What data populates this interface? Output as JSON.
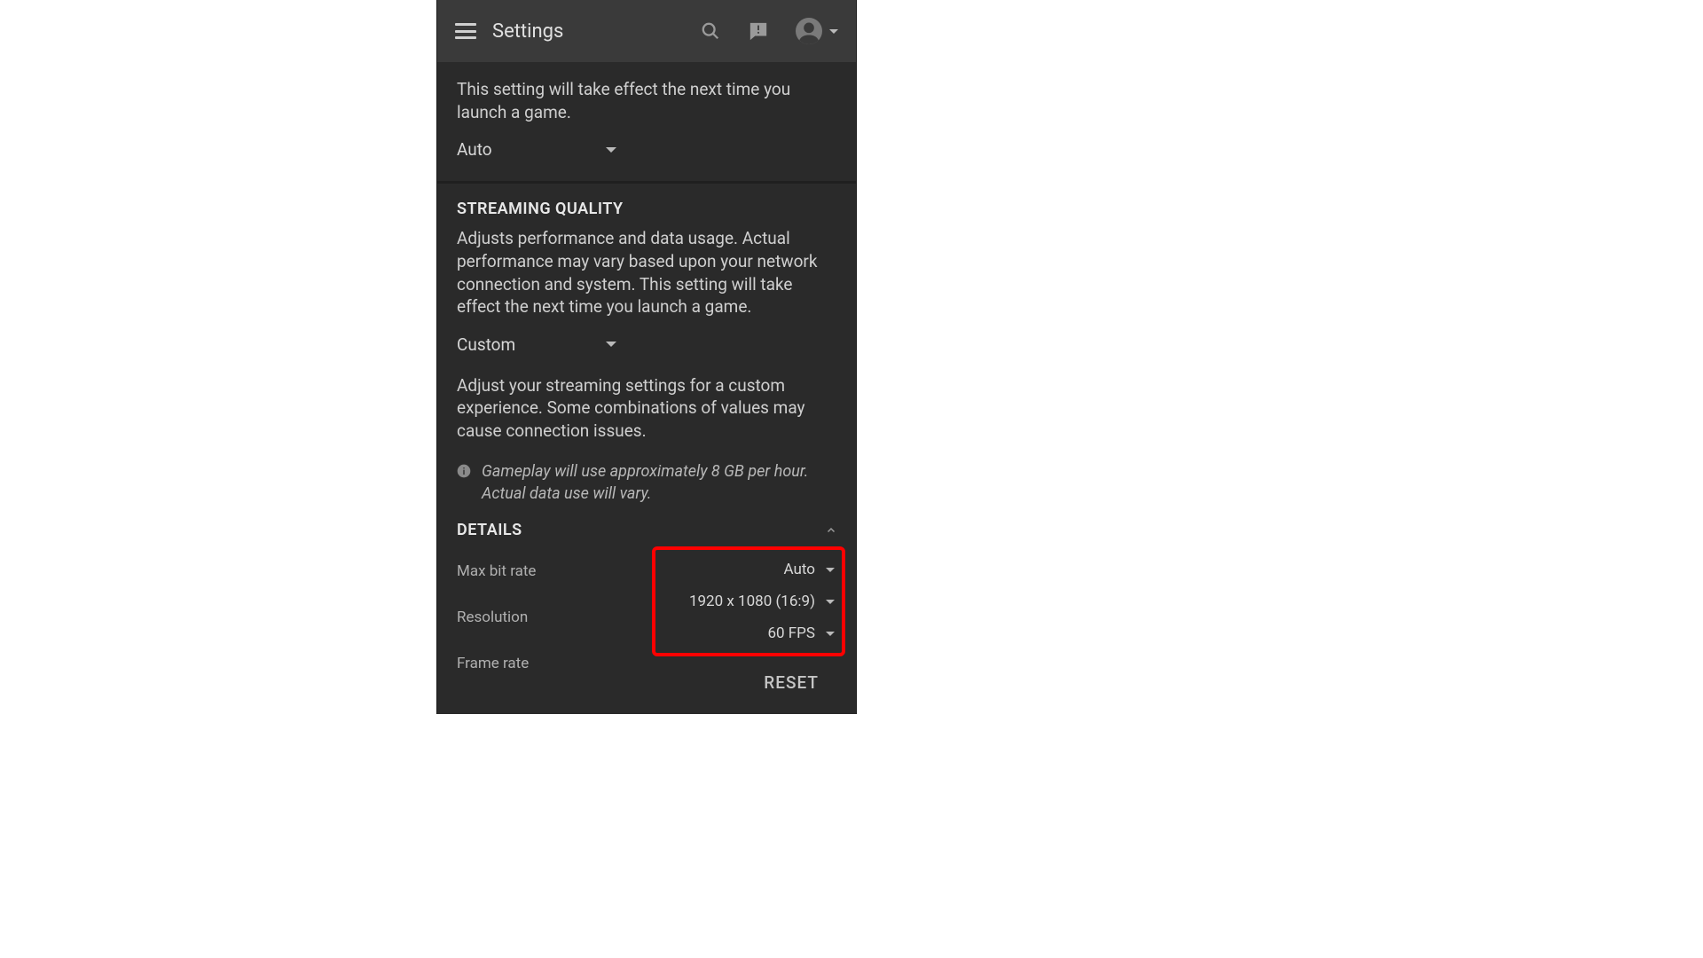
{
  "header": {
    "title": "Settings"
  },
  "section_top": {
    "desc": "This setting will take effect the next time you launch a game.",
    "dropdown_value": "Auto"
  },
  "streaming": {
    "title": "STREAMING QUALITY",
    "desc": "Adjusts performance and data usage. Actual performance may vary based upon your network connection and system. This setting will take effect the next time you launch a game.",
    "dropdown_value": "Custom",
    "custom_desc": "Adjust your streaming settings for a custom experience. Some combinations of values may cause connection issues.",
    "data_note": "Gameplay will use approximately 8 GB per hour. Actual data use will vary."
  },
  "details": {
    "title": "DETAILS",
    "rows": [
      {
        "label": "Max bit rate",
        "value": "Auto"
      },
      {
        "label": "Resolution",
        "value": "1920 x 1080 (16:9)"
      },
      {
        "label": "Frame rate",
        "value": "60 FPS"
      }
    ]
  },
  "reset": "RESET"
}
